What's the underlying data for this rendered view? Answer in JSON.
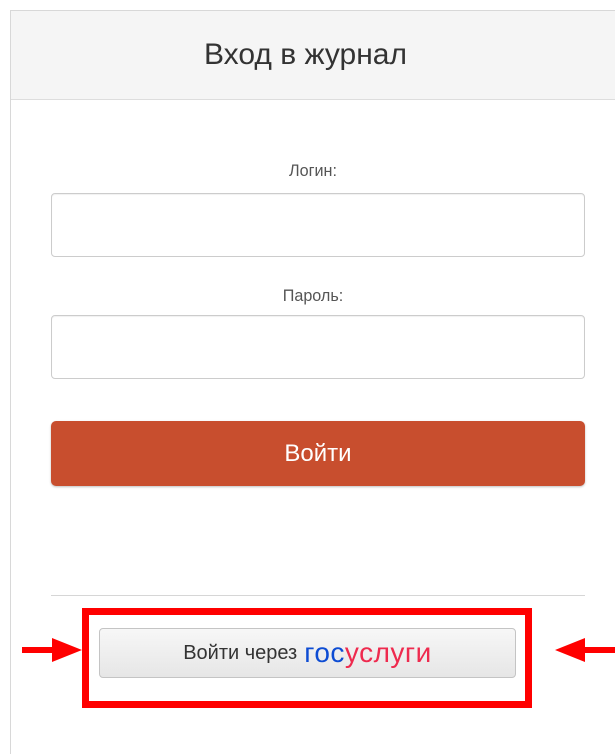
{
  "header": {
    "title": "Вход в журнал"
  },
  "form": {
    "login_label": "Логин:",
    "login_value": "",
    "password_label": "Пароль:",
    "password_value": "",
    "submit_label": "Войти"
  },
  "gosuslugi": {
    "prefix": "Войти через",
    "brand_part1": "гос",
    "brand_part2": "услуги"
  },
  "colors": {
    "submit_button": "#c84e2e",
    "highlight_box": "#ff0000",
    "annotation_arrow": "#ff0000",
    "brand_blue": "#0d4cd3",
    "brand_red": "#ee2a4e"
  }
}
